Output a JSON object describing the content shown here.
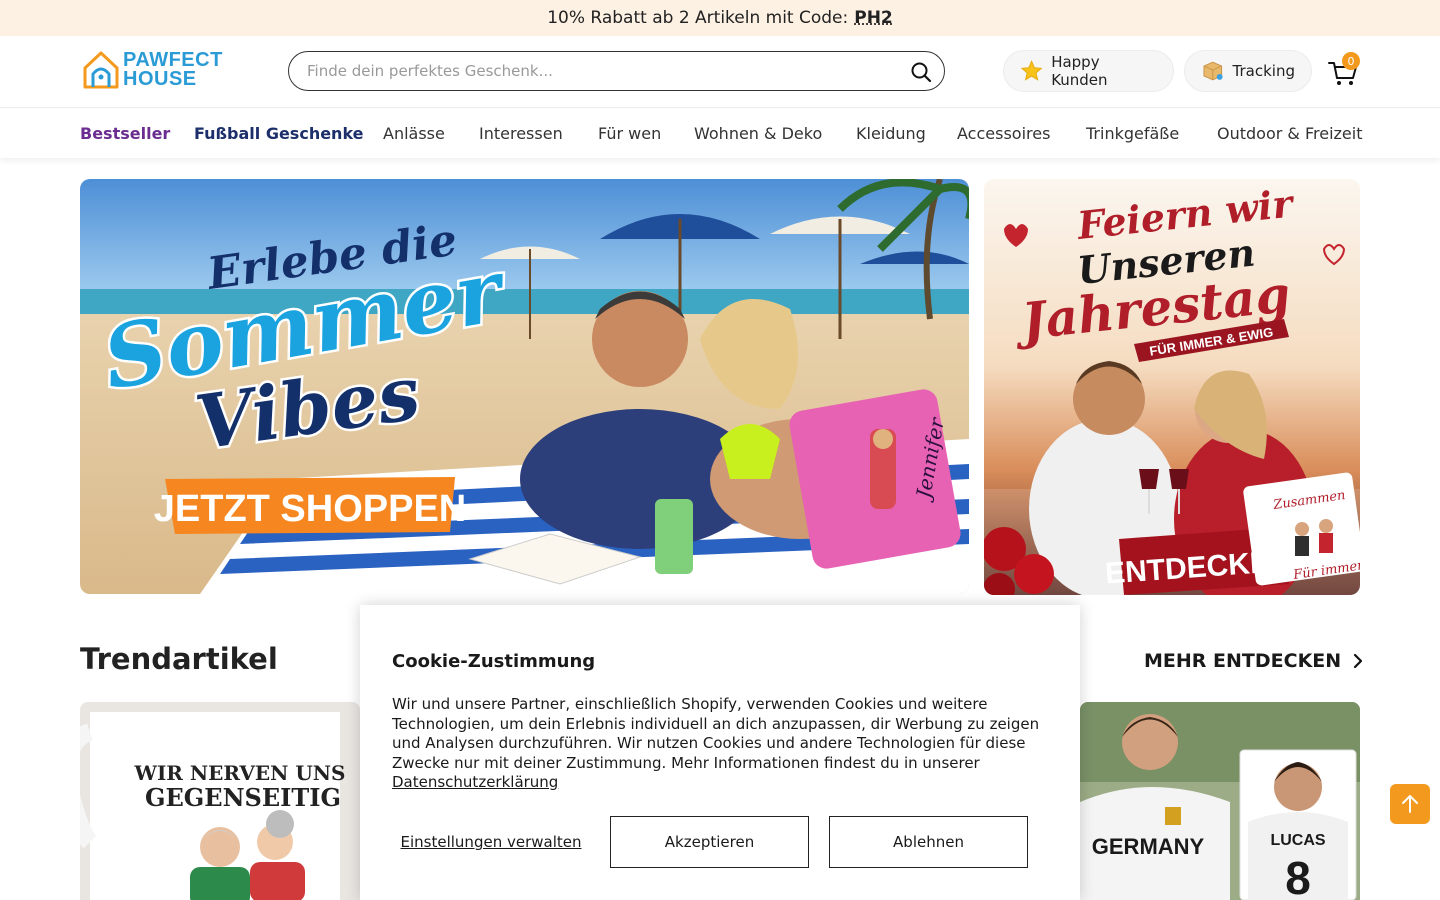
{
  "promo": {
    "text": "10% Rabatt ab 2 Artikeln mit Code:",
    "code": "PH2"
  },
  "logo": {
    "line1": "PAWFECT",
    "line2": "HOUSE"
  },
  "search": {
    "placeholder": "Finde dein perfektes Geschenk..."
  },
  "header": {
    "happy_label": "Happy Kunden",
    "tracking_label": "Tracking",
    "cart_count": "0"
  },
  "nav": {
    "items": [
      "Bestseller",
      "Fußball Geschenke",
      "Anlässe",
      "Interessen",
      "Für wen",
      "Wohnen & Deko",
      "Kleidung",
      "Accessoires",
      "Trinkgefäße",
      "Outdoor & Freizeit"
    ]
  },
  "banners": {
    "main": {
      "line1": "Erlebe die",
      "line2": "Sommer",
      "line3": "Vibes",
      "cta": "JETZT SHOPPEN",
      "pillow_name": "Jennifer"
    },
    "side": {
      "line1": "Feiern wir",
      "line2": "Unseren",
      "line3": "Jahrestag",
      "ribbon": "FÜR IMMER & EWIG",
      "cta": "ENTDECKEN",
      "card_top": "Zusammen",
      "card_bottom": "Für immer"
    }
  },
  "trending": {
    "title": "Trendartikel",
    "more": "MEHR ENTDECKEN",
    "mug_text_1": "WIR NERVEN UNS",
    "mug_text_2": "GEGENSEITIG",
    "jersey_text": "GERMANY",
    "jersey_name": "LUCAS",
    "jersey_number": "8"
  },
  "cookie": {
    "title": "Cookie-Zustimmung",
    "body": "Wir und unsere Partner, einschließlich Shopify, verwenden Cookies und weitere Technologien, um dein Erlebnis individuell an dich anzupassen, dir Werbung zu zeigen und Analysen durchzuführen. Wir nutzen Cookies und andere Technologien für diese Zwecke nur mit deiner Zustimmung. Mehr Informationen findest du in unserer",
    "link": "Datenschutzerklärung",
    "settings": "Einstellungen verwalten",
    "accept": "Akzeptieren",
    "decline": "Ablehnen"
  },
  "colors": {
    "accent": "#f39a1e",
    "brand_blue": "#2b9bd6",
    "nav_purple": "#6b2d8f",
    "nav_navy": "#1c2f6b",
    "promo_bg": "#fdf1e4"
  },
  "icons": [
    "logo-house-icon",
    "search-icon",
    "star-icon",
    "package-icon",
    "cart-icon",
    "chevron-right-icon",
    "arrow-up-icon"
  ]
}
